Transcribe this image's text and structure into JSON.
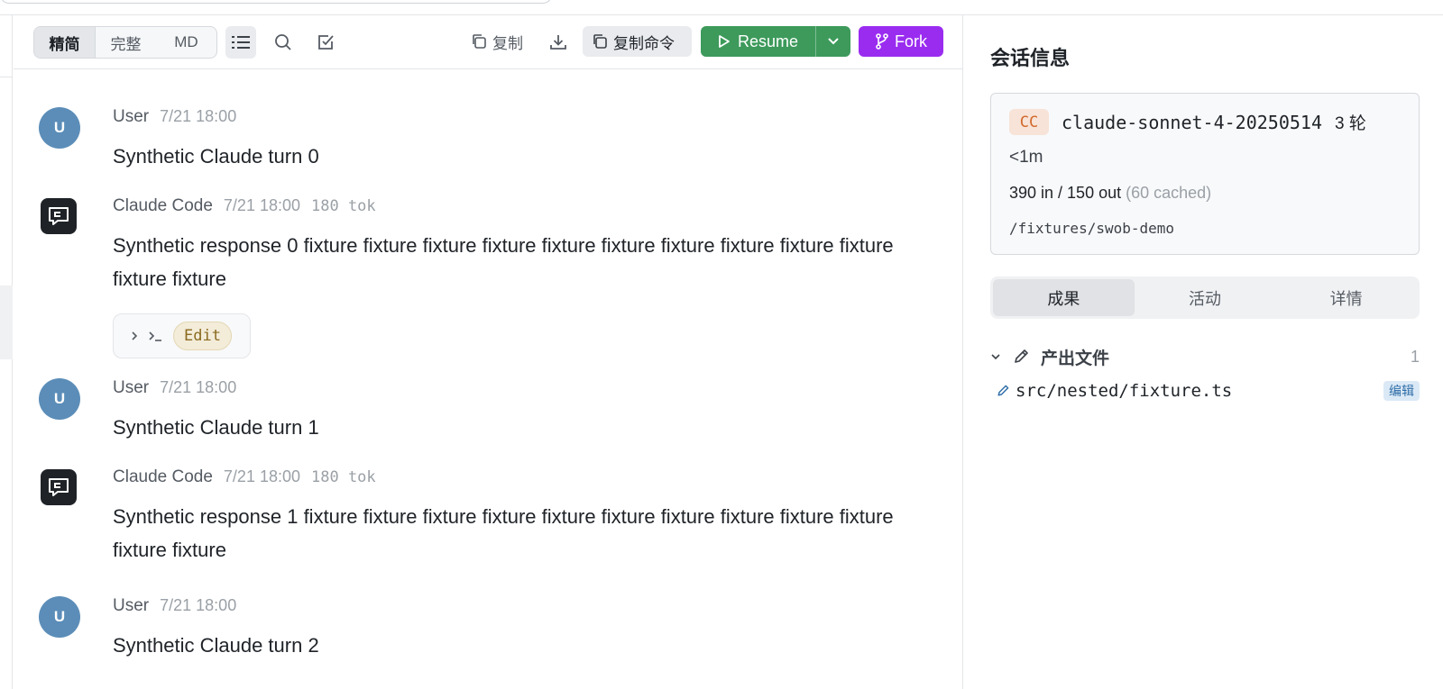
{
  "toolbar": {
    "view_modes": [
      "精简",
      "完整",
      "MD"
    ],
    "copy_label": "复制",
    "copy_command_label": "复制命令",
    "resume_label": "Resume",
    "fork_label": "Fork"
  },
  "messages": [
    {
      "role": "User",
      "avatar": "U",
      "time": "7/21 18:00",
      "text": "Synthetic Claude turn 0"
    },
    {
      "role": "Claude Code",
      "time": "7/21 18:00",
      "tokens": "180 tok",
      "text": "Synthetic response 0 fixture fixture fixture fixture fixture fixture fixture fixture fixture fixture fixture fixture",
      "tool_label": "Edit"
    },
    {
      "role": "User",
      "avatar": "U",
      "time": "7/21 18:00",
      "text": "Synthetic Claude turn 1"
    },
    {
      "role": "Claude Code",
      "time": "7/21 18:00",
      "tokens": "180 tok",
      "text": "Synthetic response 1 fixture fixture fixture fixture fixture fixture fixture fixture fixture fixture fixture fixture"
    },
    {
      "role": "User",
      "avatar": "U",
      "time": "7/21 18:00",
      "text": "Synthetic Claude turn 2"
    }
  ],
  "sidebar": {
    "title": "会话信息",
    "session": {
      "badge": "CC",
      "model": "claude-sonnet-4-20250514",
      "turns": "3 轮",
      "duration": "<1m",
      "tokens": "390 in / 150 out",
      "cached": "(60 cached)",
      "path": "/fixtures/swob-demo"
    },
    "tabs": [
      "成果",
      "活动",
      "详情"
    ],
    "files_title": "产出文件",
    "files_count": "1",
    "files": [
      {
        "name": "src/nested/fixture.ts",
        "tag": "编辑"
      }
    ]
  },
  "colors": {
    "resume": "#3d9a5b",
    "fork": "#9a2cf0",
    "user_avatar": "#5b8db8",
    "cc_badge": "#d2692e"
  }
}
